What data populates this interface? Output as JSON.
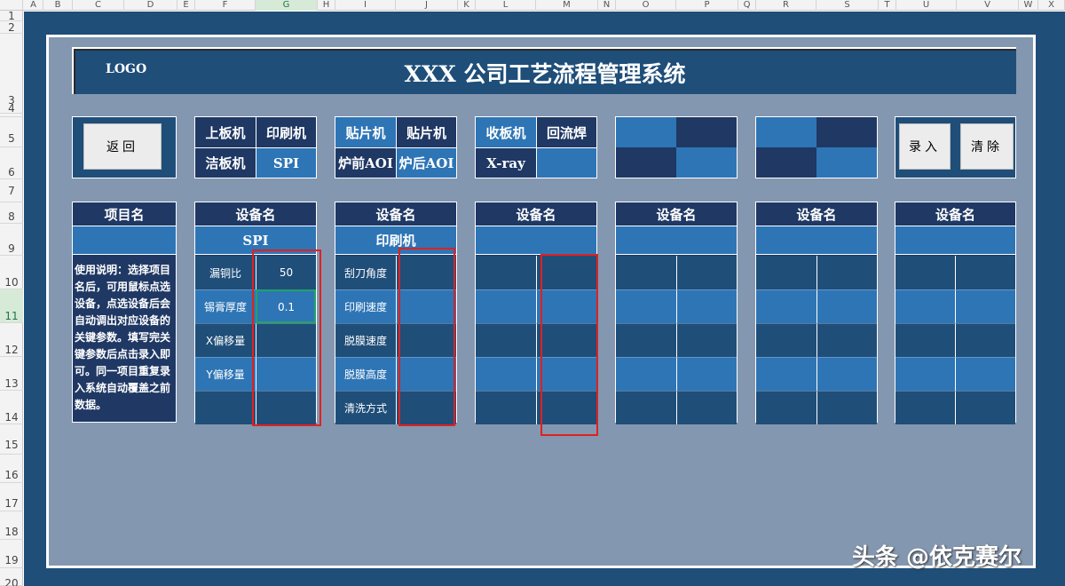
{
  "columns": [
    "A",
    "B",
    "C",
    "D",
    "E",
    "F",
    "G",
    "H",
    "I",
    "J",
    "K",
    "L",
    "M",
    "N",
    "O",
    "P",
    "Q",
    "R",
    "S",
    "T",
    "U",
    "V",
    "W",
    "X"
  ],
  "rows": [
    "1",
    "2",
    "3",
    "4",
    "5",
    "6",
    "7",
    "8",
    "9",
    "10",
    "11",
    "12",
    "13",
    "14",
    "15",
    "16",
    "17",
    "18",
    "19",
    "20"
  ],
  "header": {
    "logo": "LOGO",
    "title": "XXX 公司工艺流程管理系统"
  },
  "buttons": {
    "back": "返回",
    "enter": "录入",
    "clear": "清除"
  },
  "device_groups": [
    {
      "top_left": "上板机",
      "top_right": "印刷机",
      "bottom_left": "洁板机",
      "bottom_right": "SPI"
    },
    {
      "top_left": "贴片机",
      "top_right": "贴片机",
      "bottom_left": "炉前AOI",
      "bottom_right": "炉后AOI"
    },
    {
      "top_left": "收板机",
      "top_right": "回流焊",
      "bottom_left": "X-ray",
      "bottom_right": ""
    }
  ],
  "project_panel": {
    "heading": "项目名",
    "instructions": "使用说明：选择项目名后，可用鼠标点选设备，点选设备后会自动调出对应设备的关键参数。填写完关键参数后点击录入即可。同一项目重复录入系统自动覆盖之前数据。"
  },
  "device_panels": [
    {
      "heading": "设备名",
      "device": "SPI",
      "params": [
        {
          "name": "漏铜比",
          "value": "50"
        },
        {
          "name": "锡膏厚度",
          "value": "0.1"
        },
        {
          "name": "X偏移量",
          "value": ""
        },
        {
          "name": "Y偏移量",
          "value": ""
        },
        {
          "name": "",
          "value": ""
        }
      ]
    },
    {
      "heading": "设备名",
      "device": "印刷机",
      "params": [
        {
          "name": "刮刀角度",
          "value": ""
        },
        {
          "name": "印刷速度",
          "value": ""
        },
        {
          "name": "脱膜速度",
          "value": ""
        },
        {
          "name": "脱膜高度",
          "value": ""
        },
        {
          "name": "清洗方式",
          "value": ""
        }
      ]
    },
    {
      "heading": "设备名",
      "device": "",
      "params": []
    },
    {
      "heading": "设备名",
      "device": "",
      "params": []
    },
    {
      "heading": "设备名",
      "device": "",
      "params": []
    },
    {
      "heading": "设备名",
      "device": "",
      "params": []
    }
  ],
  "watermark": "头条 @依克赛尔",
  "colors": {
    "sheet": "#1f4e79",
    "panel": "#8497b0",
    "navy": "#1f3864",
    "light": "#2e75b6",
    "highlight": "#e02020"
  }
}
